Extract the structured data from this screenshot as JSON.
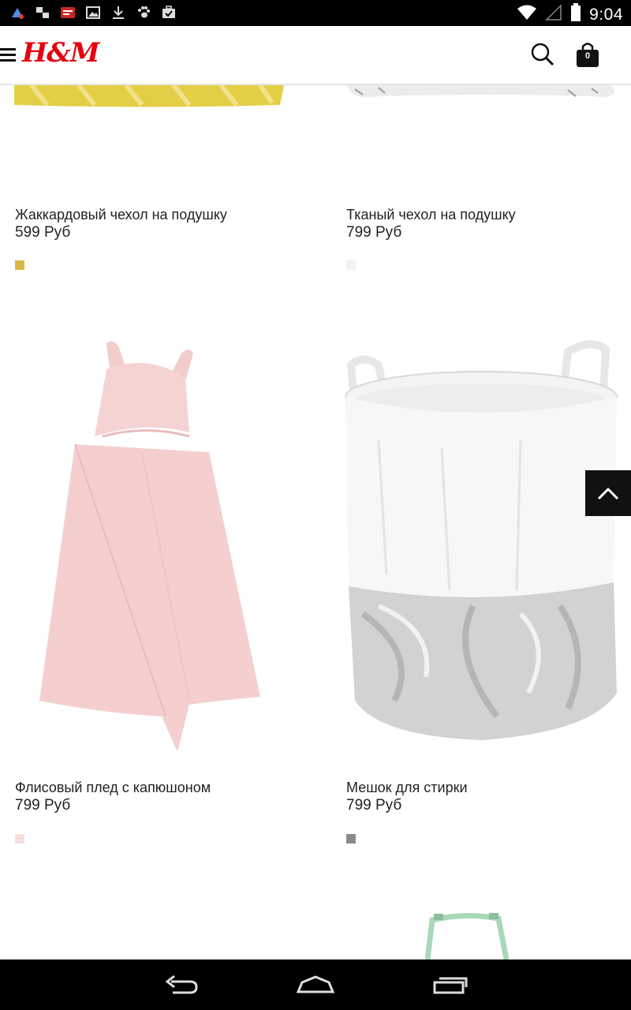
{
  "status_bar": {
    "time": "9:04",
    "left_icons": [
      "app-notification-icon",
      "transfer-icon",
      "message-icon",
      "image-icon",
      "download-icon",
      "paw-icon",
      "briefcase-check-icon"
    ],
    "right_icons": [
      "wifi-icon",
      "signal-icon",
      "battery-icon"
    ]
  },
  "header": {
    "logo": "H&M",
    "cart_count": "0"
  },
  "products": [
    {
      "title": "Жаккардовый чехол на подушку",
      "price": "599 Руб",
      "swatch_color": "#d9b84a"
    },
    {
      "title": "Тканый чехол на подушку",
      "price": "799 Руб",
      "swatch_color": "#f2f2f2"
    },
    {
      "title": "Флисовый плед с капюшоном",
      "price": "799 Руб",
      "swatch_color": "#f6dede"
    },
    {
      "title": "Мешок для стирки",
      "price": "799 Руб",
      "swatch_color": "#8a8a8a"
    }
  ],
  "colors": {
    "brand_red": "#e50010",
    "pillow_yellow": "#e3cf45",
    "blanket_pink": "#f5cfcf",
    "hamper_handle_green": "#a9d8b8"
  }
}
